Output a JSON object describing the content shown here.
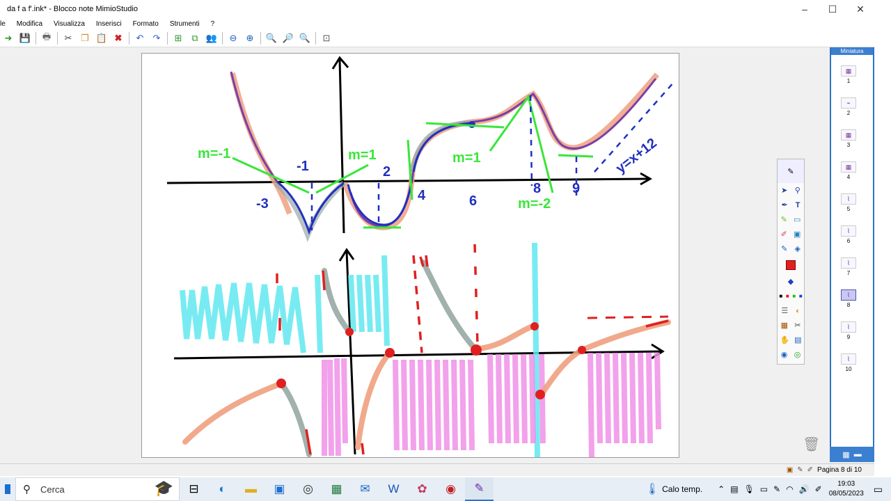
{
  "window": {
    "title": "da f a f'.ink* - Blocco note MimioStudio",
    "controls": [
      "–",
      "☐",
      "✕"
    ]
  },
  "menu": [
    "le",
    "Modifica",
    "Visualizza",
    "Inserisci",
    "Formato",
    "Strumenti",
    "?"
  ],
  "toolbar": {
    "icons": [
      "open-icon",
      "save-icon",
      "print-icon",
      "cut-icon",
      "copy-icon",
      "paste-icon",
      "delete-icon",
      "undo-icon",
      "redo-icon",
      "new-page-icon",
      "duplicate-page-icon",
      "people-icon",
      "back-icon",
      "forward-icon",
      "zoom-icon",
      "zoom-out-icon",
      "zoom-in-icon",
      "fit-icon"
    ]
  },
  "canvas": {
    "upper_labels": [
      "m=-1",
      "-1",
      "m=1",
      "2",
      "-3",
      "4",
      "6",
      "m=1",
      "8",
      "9",
      "m=-2",
      "y=x+12"
    ],
    "accent_colors": {
      "green": "#39e639",
      "blue": "#2030c0",
      "salmon": "#f0a080",
      "purple": "#8040a0",
      "cyan": "#60e8f0",
      "pink": "#f090e8",
      "red": "#e02020"
    }
  },
  "thumbnails": {
    "header": "Miniatura",
    "pages": [
      "1",
      "2",
      "3",
      "4",
      "5",
      "6",
      "7",
      "8",
      "9",
      "10"
    ],
    "active": "8"
  },
  "status": {
    "page": "Pagina 8 di 10"
  },
  "taskbar": {
    "search_label": "Cerca",
    "weather": "Calo temp.",
    "time": "19:03",
    "date": "08/05/2023"
  }
}
